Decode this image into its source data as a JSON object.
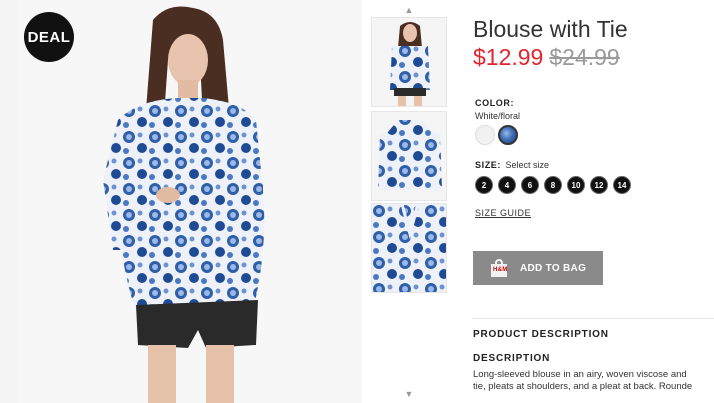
{
  "badge": {
    "label": "DEAL"
  },
  "product": {
    "title": "Blouse with Tie",
    "sale_price": "$12.99",
    "original_price": "$24.99"
  },
  "color": {
    "label": "COLOR:",
    "value": "White/floral",
    "swatches": [
      {
        "name": "white",
        "color": "#f1f1f1"
      },
      {
        "name": "white-floral",
        "color": "#3e6fb8",
        "selected": true
      }
    ]
  },
  "size": {
    "label": "SIZE:",
    "placeholder": "Select size",
    "options": [
      "2",
      "4",
      "6",
      "8",
      "10",
      "12",
      "14"
    ]
  },
  "size_guide": "SIZE GUIDE",
  "add_to_bag": {
    "label": "ADD TO BAG",
    "icon": "shopping-bag-icon"
  },
  "description": {
    "section_title": "PRODUCT DESCRIPTION",
    "heading": "DESCRIPTION",
    "lines": [
      "Long-sleeved blouse in an airy, woven viscose and",
      "tie, pleats at shoulders, and a pleat at back. Rounde"
    ]
  },
  "colors": {
    "sale": "#e0252e",
    "old_price": "#9a9a9a",
    "button": "#8a8a8a",
    "badge": "#111111",
    "floral_blue": "#2f5fa8"
  },
  "icons": {
    "thumb_up": "chevron-up-icon",
    "thumb_down": "chevron-down-icon"
  }
}
